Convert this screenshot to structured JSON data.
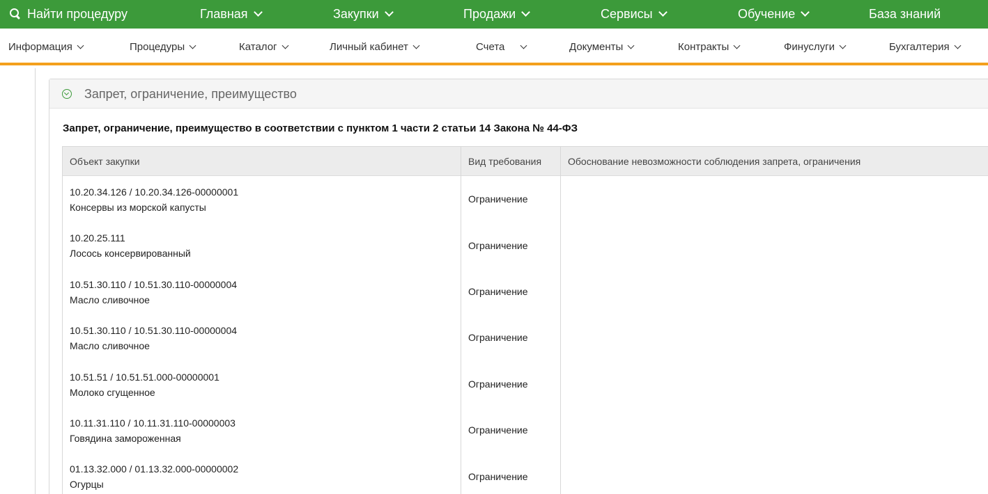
{
  "topnav": {
    "search": "Найти процедуру",
    "items": [
      "Главная",
      "Закупки",
      "Продажи",
      "Сервисы",
      "Обучение",
      "База знаний"
    ]
  },
  "subnav": {
    "items": [
      "Информация",
      "Процедуры",
      "Каталог",
      "Личный кабинет",
      "Счета",
      "Документы",
      "Контракты",
      "Финуслуги",
      "Бухгалтерия"
    ]
  },
  "panel": {
    "title": "Запрет, ограничение, преимущество"
  },
  "section": {
    "title": "Запрет, ограничение, преимущество в соответствии с пунктом 1 части 2 статьи 14 Закона № 44-ФЗ"
  },
  "table": {
    "headers": [
      "Объект закупки",
      "Вид требования",
      "Обоснование невозможности соблюдения запрета, ограничения"
    ],
    "rows": [
      {
        "code": "10.20.34.126 / 10.20.34.126-00000001",
        "name": "Консервы из морской капусты",
        "type": "Ограничение",
        "reason": ""
      },
      {
        "code": "10.20.25.111",
        "name": "Лосось консервированный",
        "type": "Ограничение",
        "reason": ""
      },
      {
        "code": "10.51.30.110 / 10.51.30.110-00000004",
        "name": "Масло сливочное",
        "type": "Ограничение",
        "reason": ""
      },
      {
        "code": "10.51.30.110 / 10.51.30.110-00000004",
        "name": "Масло сливочное",
        "type": "Ограничение",
        "reason": ""
      },
      {
        "code": "10.51.51 / 10.51.51.000-00000001",
        "name": "Молоко сгущенное",
        "type": "Ограничение",
        "reason": ""
      },
      {
        "code": "10.11.31.110 / 10.11.31.110-00000003",
        "name": "Говядина замороженная",
        "type": "Ограничение",
        "reason": ""
      },
      {
        "code": "01.13.32.000 / 01.13.32.000-00000002",
        "name": "Огурцы",
        "type": "Ограничение",
        "reason": ""
      }
    ]
  },
  "colors": {
    "topbar": "#3c9a3a",
    "accent_line": "#f4a01c"
  }
}
